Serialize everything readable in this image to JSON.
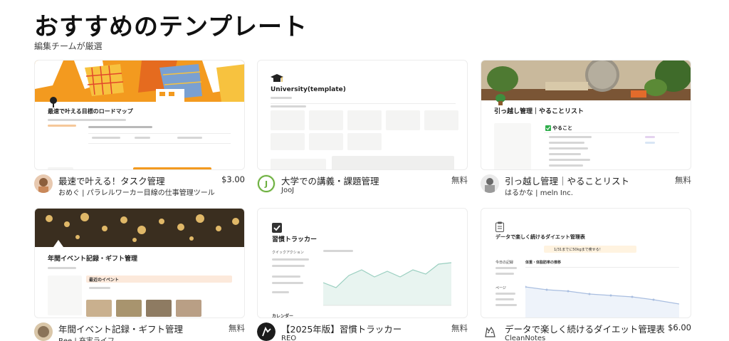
{
  "header": {
    "title": "おすすめのテンプレート",
    "subtitle": "編集チームが厳選"
  },
  "cards": [
    {
      "title": "最速で叶える！タスク管理",
      "creator": "おめぐ | パラレルワーカー目線の仕事管理ツール",
      "price": "$3.00",
      "preview_title": "最速で叶える目標のロードマップ"
    },
    {
      "title": "大学での講義・課題管理",
      "creator": "JooJ",
      "price": "無料",
      "preview_title": "University(template)"
    },
    {
      "title": "引っ越し管理｜やることリスト",
      "creator": "はるかな | meln Inc.",
      "price": "無料",
      "preview_title": "引っ越し管理｜やることリスト",
      "preview_section": "やること"
    },
    {
      "title": "年間イベント記録・ギフト管理",
      "creator": "Bee | 充実ライフ",
      "price": "無料",
      "preview_title": "年間イベント記録・ギフト管理",
      "preview_section": "最近のイベント"
    },
    {
      "title": "【2025年版】習慣トラッカー",
      "creator": "REO",
      "price": "無料",
      "preview_title": "習慣トラッカー",
      "preview_side_label": "クイックアクション",
      "preview_footer": "カレンダー"
    },
    {
      "title": "データで楽しく続けるダイエット管理表",
      "creator": "CleanNotes",
      "price": "$6.00",
      "preview_title": "データで楽しく続けるダイエット管理表",
      "preview_side_label": "今日の記録",
      "preview_side_label2": "ページ",
      "preview_banner": "1/31までに50kgまで痩せる！",
      "preview_chart_title": "体重・体脂肪率の推移"
    }
  ],
  "colors": {
    "accent_orange": "#F39A1F",
    "diet_banner": "#FFF3E0",
    "check_green": "#2EAD4B"
  },
  "icons": {
    "card2": "graduation-cap-icon",
    "card5": "checkbox-icon",
    "card6": "clipboard-icon"
  }
}
